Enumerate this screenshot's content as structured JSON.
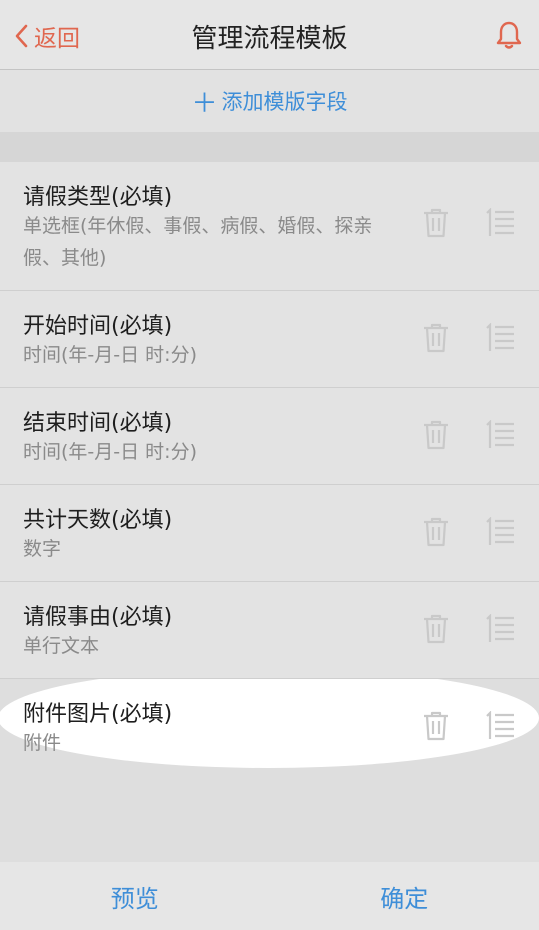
{
  "header": {
    "back_label": "返回",
    "title": "管理流程模板"
  },
  "add_field": {
    "label": "添加模版字段"
  },
  "fields": [
    {
      "name": "请假类型(必填)",
      "type": "单选框(年休假、事假、病假、婚假、探亲假、其他)"
    },
    {
      "name": "开始时间(必填)",
      "type": "时间(年-月-日 时:分)"
    },
    {
      "name": "结束时间(必填)",
      "type": "时间(年-月-日 时:分)"
    },
    {
      "name": "共计天数(必填)",
      "type": "数字"
    },
    {
      "name": "请假事由(必填)",
      "type": "单行文本"
    },
    {
      "name": "附件图片(必填)",
      "type": "附件"
    }
  ],
  "footer": {
    "preview_label": "预览",
    "confirm_label": "确定"
  },
  "colors": {
    "accent_blue": "#3e8ed8",
    "back_orange": "#e0674f"
  },
  "icons": [
    "chevron-left-icon",
    "bell-icon",
    "plus-icon",
    "trash-icon",
    "sort-list-icon"
  ]
}
